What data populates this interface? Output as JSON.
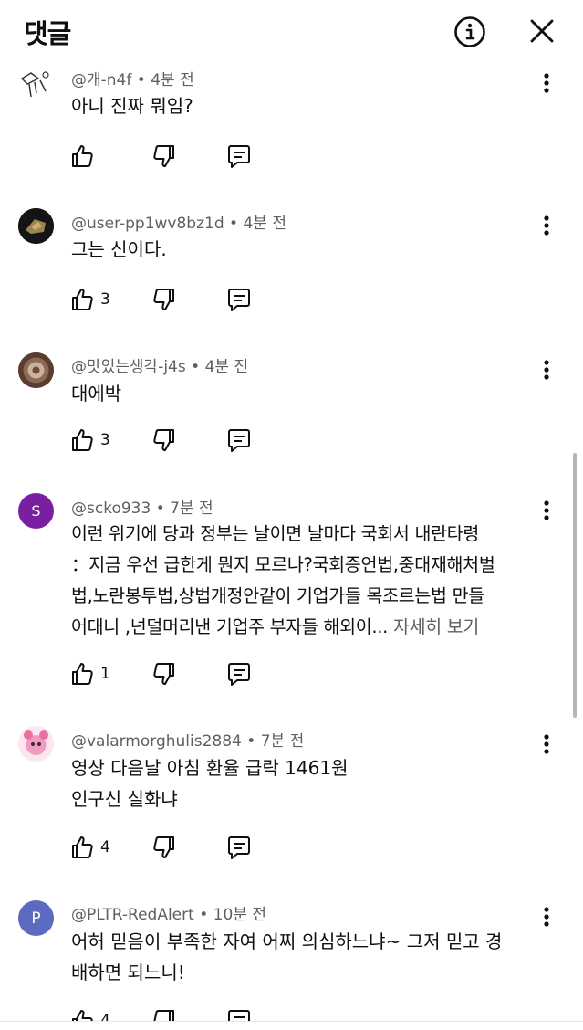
{
  "header": {
    "title": "댓글",
    "info_icon": "info-circle-icon",
    "close_icon": "close-icon"
  },
  "comments": [
    {
      "author": "@개-n4f",
      "time": "4분 전",
      "text": "아니 진짜 뭐임?",
      "likes": "",
      "avatar": {
        "type": "drawing",
        "bg": "#ffffff"
      }
    },
    {
      "author": "@user-pp1wv8bz1d",
      "time": "4분 전",
      "text": "그는 신이다.",
      "likes": "3",
      "avatar": {
        "type": "photo",
        "bg": "#1a1a1a"
      }
    },
    {
      "author": "@맛있는생각-j4s",
      "time": "4분 전",
      "text": "대에박",
      "likes": "3",
      "avatar": {
        "type": "photo",
        "bg": "#6b4a3a"
      }
    },
    {
      "author": "@scko933",
      "time": "7분 전",
      "text_lines": [
        "이런 위기에 당과 정부는 날이면 날마다 국회서 내란타령",
        "：지금 우선 급한게 뭔지 모르나?국회증언법,중대재해처벌",
        "법,노란봉투법,상법개정안같이 기업가들 목조르는법 만들",
        "어대니 ,넌덜머리낸 기업주 부자들 해외이... "
      ],
      "read_more": "자세히 보기",
      "likes": "1",
      "avatar": {
        "type": "letter",
        "letter": "S",
        "bg": "#7b1fa2"
      }
    },
    {
      "author": "@valarmorghulis2884",
      "time": "7분 전",
      "text_lines": [
        "영상 다음날 아침 환율 급락 1461원",
        "인구신 실화냐"
      ],
      "likes": "4",
      "avatar": {
        "type": "photo",
        "bg": "#f5c6d6"
      }
    },
    {
      "author": "@PLTR-RedAlert",
      "time": "10분 전",
      "text_lines": [
        "어허 믿음이 부족한 자여 어찌 의심하느냐~ 그저 믿고 경",
        "배하면 되느니!"
      ],
      "likes": "4",
      "avatar": {
        "type": "letter",
        "letter": "P",
        "bg": "#5c6bc0"
      }
    }
  ],
  "icons": {
    "like": "thumbs-up-icon",
    "dislike": "thumbs-down-icon",
    "reply": "reply-icon",
    "more": "more-vert-icon"
  },
  "colors": {
    "meta": "#606060",
    "text": "#0f0f0f",
    "divider": "#e5e5e5"
  }
}
